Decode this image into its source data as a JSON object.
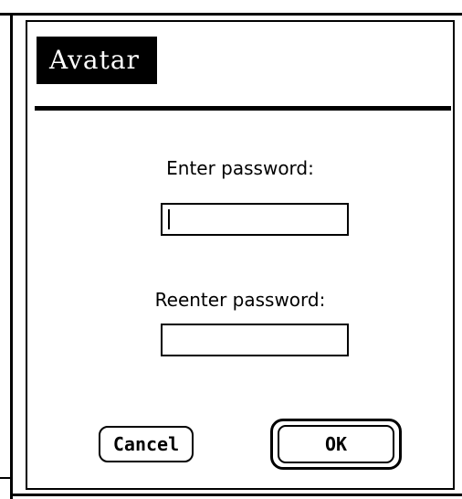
{
  "dialog": {
    "app_name": "Avatar",
    "enter_label": "Enter password:",
    "reenter_label": "Reenter password:",
    "enter_value": "",
    "reenter_value": "",
    "cancel_label": "Cancel",
    "ok_label": "OK"
  }
}
